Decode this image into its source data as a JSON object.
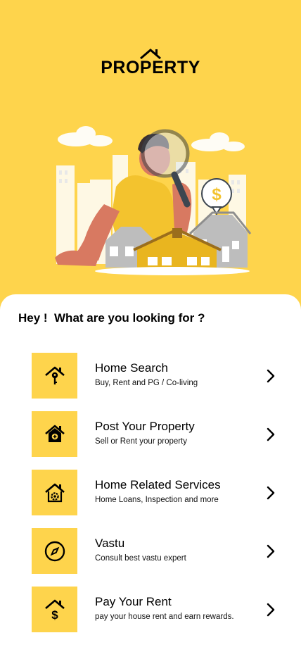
{
  "app": {
    "logo_text": "PROPERTY"
  },
  "illustration": {
    "dollar_symbol": "$"
  },
  "main": {
    "question": "Hey !  What are you looking for ?",
    "options": [
      {
        "title": "Home Search",
        "subtitle": "Buy, Rent and PG / Co-living",
        "icon": "home-key-icon"
      },
      {
        "title": "Post Your Property",
        "subtitle": "Sell or Rent your property",
        "icon": "home-post-icon"
      },
      {
        "title": "Home Related Services",
        "subtitle": "Home Loans, Inspection and more",
        "icon": "home-gear-icon"
      },
      {
        "title": "Vastu",
        "subtitle": "Consult best vastu expert",
        "icon": "compass-icon"
      },
      {
        "title": "Pay Your Rent",
        "subtitle": "pay your house rent and earn rewards.",
        "icon": "home-dollar-icon"
      }
    ]
  },
  "colors": {
    "accent": "#FED44C",
    "sheet": "#FFFFFF",
    "text": "#000000"
  }
}
